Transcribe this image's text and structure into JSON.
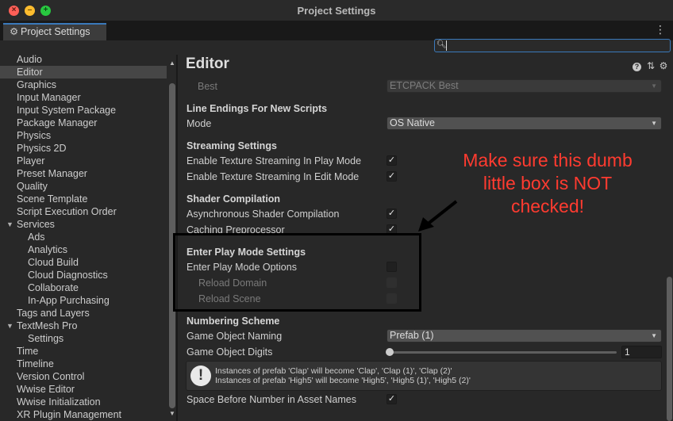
{
  "window": {
    "title": "Project Settings"
  },
  "tab": {
    "label": "Project Settings"
  },
  "search": {
    "value": "",
    "placeholder": ""
  },
  "sidebar": {
    "items": [
      {
        "label": "Audio",
        "indent": 0
      },
      {
        "label": "Editor",
        "indent": 0,
        "selected": true
      },
      {
        "label": "Graphics",
        "indent": 0
      },
      {
        "label": "Input Manager",
        "indent": 0
      },
      {
        "label": "Input System Package",
        "indent": 0
      },
      {
        "label": "Package Manager",
        "indent": 0
      },
      {
        "label": "Physics",
        "indent": 0
      },
      {
        "label": "Physics 2D",
        "indent": 0
      },
      {
        "label": "Player",
        "indent": 0
      },
      {
        "label": "Preset Manager",
        "indent": 0
      },
      {
        "label": "Quality",
        "indent": 0
      },
      {
        "label": "Scene Template",
        "indent": 0
      },
      {
        "label": "Script Execution Order",
        "indent": 0
      },
      {
        "label": "Services",
        "indent": 0,
        "expanded": true
      },
      {
        "label": "Ads",
        "indent": 1
      },
      {
        "label": "Analytics",
        "indent": 1
      },
      {
        "label": "Cloud Build",
        "indent": 1
      },
      {
        "label": "Cloud Diagnostics",
        "indent": 1
      },
      {
        "label": "Collaborate",
        "indent": 1
      },
      {
        "label": "In-App Purchasing",
        "indent": 1
      },
      {
        "label": "Tags and Layers",
        "indent": 0
      },
      {
        "label": "TextMesh Pro",
        "indent": 0,
        "expanded": true
      },
      {
        "label": "Settings",
        "indent": 1
      },
      {
        "label": "Time",
        "indent": 0
      },
      {
        "label": "Timeline",
        "indent": 0
      },
      {
        "label": "Version Control",
        "indent": 0
      },
      {
        "label": "Wwise Editor",
        "indent": 0
      },
      {
        "label": "Wwise Initialization",
        "indent": 0
      },
      {
        "label": "XR Plugin Management",
        "indent": 0
      }
    ]
  },
  "main": {
    "title": "Editor",
    "best_label": "Best",
    "best_value": "ETCPACK Best",
    "line_endings": {
      "header": "Line Endings For New Scripts",
      "mode_label": "Mode",
      "mode_value": "OS Native"
    },
    "streaming": {
      "header": "Streaming Settings",
      "play_label": "Enable Texture Streaming In Play Mode",
      "play_checked": true,
      "edit_label": "Enable Texture Streaming In Edit Mode",
      "edit_checked": true
    },
    "shader": {
      "header": "Shader Compilation",
      "async_label": "Asynchronous Shader Compilation",
      "async_checked": true,
      "caching_label": "Caching Preprocessor",
      "caching_checked": true
    },
    "play_mode": {
      "header": "Enter Play Mode Settings",
      "options_label": "Enter Play Mode Options",
      "options_checked": false,
      "reload_domain_label": "Reload Domain",
      "reload_domain_checked": false,
      "reload_scene_label": "Reload Scene",
      "reload_scene_checked": false
    },
    "numbering": {
      "header": "Numbering Scheme",
      "naming_label": "Game Object Naming",
      "naming_value": "Prefab (1)",
      "digits_label": "Game Object Digits",
      "digits_value": "1",
      "help_line1": "Instances of prefab 'Clap' will become 'Clap', 'Clap (1)', 'Clap (2)'",
      "help_line2": "Instances of prefab 'High5' will become 'High5', 'High5 (1)', 'High5 (2)'",
      "space_label": "Space Before Number in Asset Names",
      "space_checked": true
    }
  },
  "annotation": {
    "text": "Make sure this dumb little box is NOT checked!",
    "color": "#ff3b30"
  }
}
